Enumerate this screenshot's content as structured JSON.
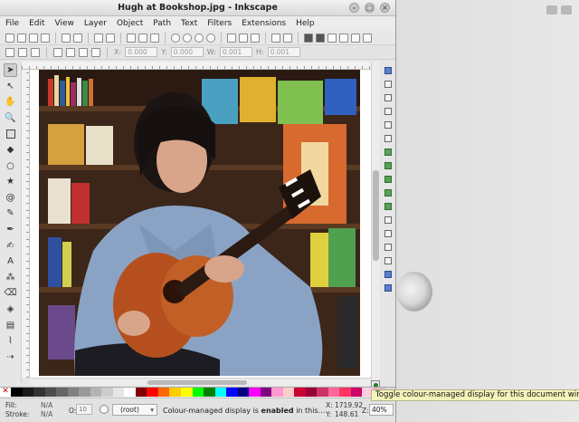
{
  "window": {
    "title": "Hugh at Bookshop.jpg - Inkscape"
  },
  "menu": {
    "items": [
      "File",
      "Edit",
      "View",
      "Layer",
      "Object",
      "Path",
      "Text",
      "Filters",
      "Extensions",
      "Help"
    ]
  },
  "controls": {
    "x_label": "X:",
    "x_value": "0.000",
    "y_label": "Y:",
    "y_value": "0.000",
    "w_label": "W:",
    "w_value": "0.001",
    "h_label": "H:",
    "h_value": "0.001"
  },
  "palette": {
    "none_symbol": "✕",
    "colors": [
      "#000000",
      "#1a1a1a",
      "#333333",
      "#4d4d4d",
      "#666666",
      "#808080",
      "#999999",
      "#b3b3b3",
      "#cccccc",
      "#e6e6e6",
      "#ffffff",
      "#800000",
      "#ff0000",
      "#ff6600",
      "#ffcc00",
      "#ffff00",
      "#00ff00",
      "#008000",
      "#00ffff",
      "#0000ff",
      "#000080",
      "#ff00ff",
      "#800080",
      "#ff99cc",
      "#ffcccc",
      "#cc0033",
      "#990033",
      "#cc3366",
      "#ff6699",
      "#ff3366",
      "#cc0066",
      "#ffccdd",
      "#e6b3c3",
      "#d9d9d9"
    ]
  },
  "status": {
    "fill_label": "Fill:",
    "fill_value": "N/A",
    "stroke_label": "Stroke:",
    "stroke_value": "N/A",
    "opacity_label": "O:",
    "opacity_value": "10",
    "layer": "(root)",
    "message_prefix": "Colour-managed display is ",
    "message_bold": "enabled",
    "message_suffix": " in this...",
    "x_label": "X:",
    "x_value": "1719.92",
    "y_label": "Y:",
    "y_value": "148.61",
    "zoom_label": "Z:",
    "zoom_value": "40%"
  },
  "tooltip": {
    "text": "Toggle colour-managed display for this document window"
  },
  "colors": {
    "tooltip_bg": "#f4f3b9",
    "cms_indicator": "#1a7a1a"
  }
}
